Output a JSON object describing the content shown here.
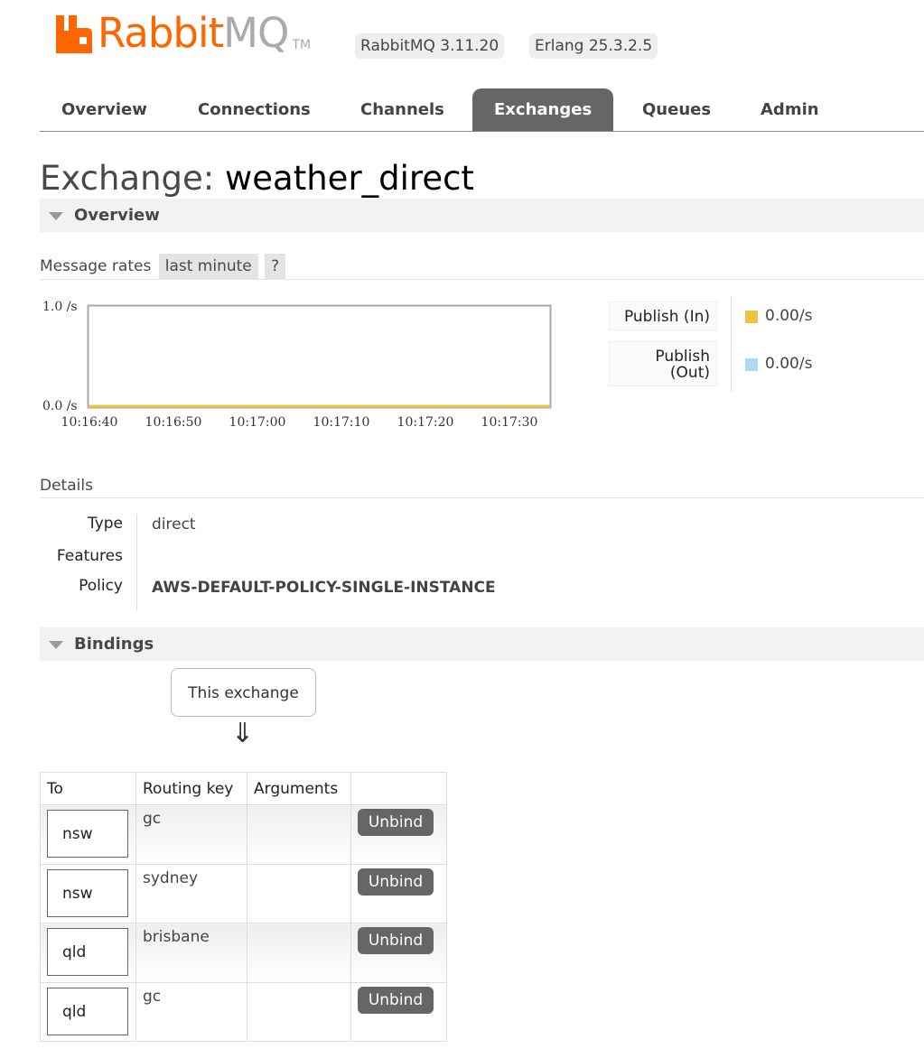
{
  "header": {
    "logo_text_primary": "Rabbit",
    "logo_text_secondary": "MQ",
    "logo_tm": "TM",
    "version_badge": "RabbitMQ 3.11.20",
    "erlang_badge": "Erlang 25.3.2.5"
  },
  "tabs": [
    {
      "label": "Overview",
      "active": false
    },
    {
      "label": "Connections",
      "active": false
    },
    {
      "label": "Channels",
      "active": false
    },
    {
      "label": "Exchanges",
      "active": true
    },
    {
      "label": "Queues",
      "active": false
    },
    {
      "label": "Admin",
      "active": false
    }
  ],
  "page": {
    "title_prefix": "Exchange:",
    "exchange_name": "weather_direct"
  },
  "overview": {
    "section_label": "Overview",
    "message_rates_label": "Message rates",
    "range_pill": "last minute",
    "help_pill": "?"
  },
  "chart_data": {
    "type": "line",
    "x": [
      "10:16:40",
      "10:16:50",
      "10:17:00",
      "10:17:10",
      "10:17:20",
      "10:17:30"
    ],
    "y_ticks": [
      "1.0 /s",
      "0.0 /s"
    ],
    "ylim": [
      0,
      1
    ],
    "series": [
      {
        "name": "Publish (In)",
        "color": "#edc240",
        "values": [
          0,
          0,
          0,
          0,
          0,
          0
        ],
        "rate": "0.00/s"
      },
      {
        "name": "Publish (Out)",
        "color": "#afd8f8",
        "values": [
          0,
          0,
          0,
          0,
          0,
          0
        ],
        "rate": "0.00/s"
      }
    ],
    "legend_labels": [
      "Publish (In)",
      "Publish\n(Out)"
    ]
  },
  "details": {
    "section_label": "Details",
    "type_label": "Type",
    "type_value": "direct",
    "features_label": "Features",
    "features_value": "",
    "policy_label": "Policy",
    "policy_value": "AWS-DEFAULT-POLICY-SINGLE-INSTANCE"
  },
  "bindings": {
    "section_label": "Bindings",
    "this_exchange": "This exchange",
    "arrow": "⇓",
    "columns": [
      "To",
      "Routing key",
      "Arguments",
      ""
    ],
    "unbind_label": "Unbind",
    "rows": [
      {
        "to": "nsw",
        "routing_key": "gc",
        "arguments": ""
      },
      {
        "to": "nsw",
        "routing_key": "sydney",
        "arguments": ""
      },
      {
        "to": "qld",
        "routing_key": "brisbane",
        "arguments": ""
      },
      {
        "to": "qld",
        "routing_key": "gc",
        "arguments": ""
      }
    ]
  }
}
